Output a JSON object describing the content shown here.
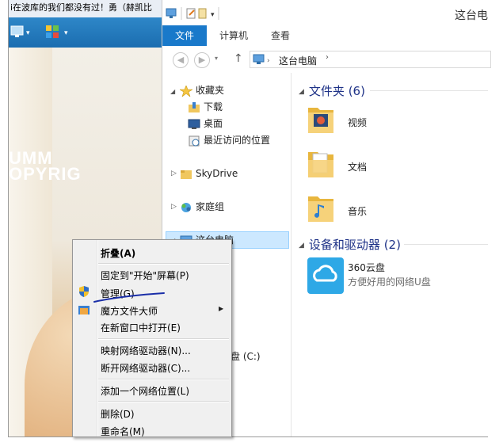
{
  "background_app": {
    "title_text": "i在波库的我们都没有过！勇（赫凯比",
    "side_text": "UMM\nOPYRIG"
  },
  "explorer": {
    "window_title": "这台电",
    "ribbon_tabs": [
      "文件",
      "计算机",
      "查看"
    ],
    "address_path": "这台电脑",
    "nav": {
      "favorites": "收藏夹",
      "downloads": "下载",
      "desktop": "桌面",
      "recent": "最近访问的位置",
      "skydrive": "SkyDrive",
      "homegroup": "家庭组",
      "this_pc": "这台电脑",
      "drive_c_partial": "盘 (C:)"
    },
    "folders_header": "文件夹 (6)",
    "folders": [
      "视频",
      "文档",
      "音乐"
    ],
    "devices_header": "设备和驱动器 (2)",
    "device": {
      "name": "360云盘",
      "desc": "方便好用的网络U盘"
    }
  },
  "context_menu": {
    "collapse": "折叠(A)",
    "pin_start": "固定到\"开始\"屏幕(P)",
    "manage": "管理(G)",
    "magic_file": "魔方文件大师",
    "open_new_window": "在新窗口中打开(E)",
    "map_drive": "映射网络驱动器(N)...",
    "disconnect_drive": "断开网络驱动器(C)...",
    "add_network_location": "添加一个网络位置(L)",
    "delete": "删除(D)",
    "rename": "重命名(M)"
  },
  "colors": {
    "accent": "#1979ca",
    "selection": "#cce8ff",
    "header_text": "#1e3287",
    "annotation": "#1a2ea8"
  }
}
